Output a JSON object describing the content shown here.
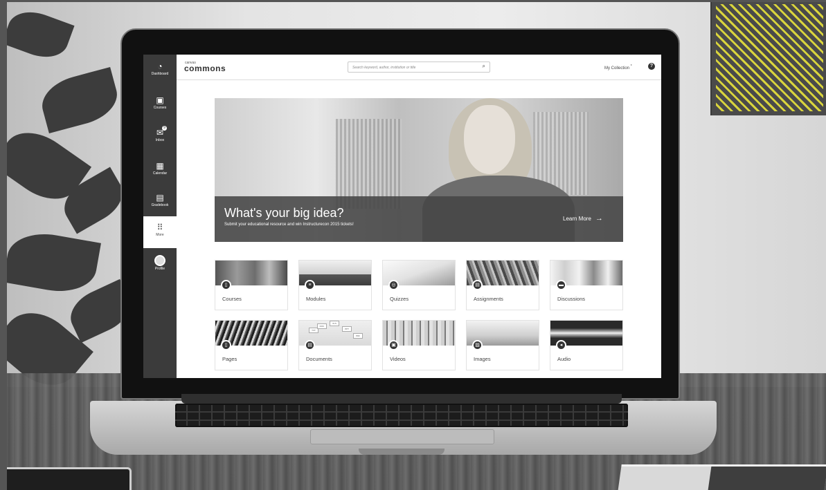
{
  "global_nav": {
    "items": [
      {
        "label": "Dashboard",
        "icon": "dashboard-icon",
        "glyph": "◔"
      },
      {
        "label": "Courses",
        "icon": "courses-icon",
        "glyph": "▣"
      },
      {
        "label": "Inbox",
        "icon": "inbox-icon",
        "glyph": "✉"
      },
      {
        "label": "Calendar",
        "icon": "calendar-icon",
        "glyph": "▦"
      },
      {
        "label": "Gradebook",
        "icon": "gradebook-icon",
        "glyph": "▤"
      },
      {
        "label": "More",
        "icon": "more-grid-icon",
        "glyph": "⠿"
      },
      {
        "label": "Profile",
        "icon": "profile-avatar-icon",
        "glyph": ""
      }
    ],
    "inbox_badge": "9"
  },
  "header": {
    "brand_small": "canvas",
    "brand": "commons",
    "search_placeholder": "Search keyword, author, institution or title",
    "my_collection": "My Collection",
    "my_collection_marker": "*",
    "help_glyph": "?"
  },
  "hero": {
    "title": "What's your big idea?",
    "subtitle": "Submit your educational resource and win Instructurecon 2015 tickets!",
    "cta": "Learn More",
    "cta_arrow": "→"
  },
  "categories": [
    {
      "label": "Courses",
      "icon": "course-icon",
      "glyph": "▯"
    },
    {
      "label": "Modules",
      "icon": "module-icon",
      "glyph": "≡"
    },
    {
      "label": "Quizzes",
      "icon": "quiz-icon",
      "glyph": "◎"
    },
    {
      "label": "Assignments",
      "icon": "assignment-icon",
      "glyph": "▤"
    },
    {
      "label": "Discussions",
      "icon": "discussion-icon",
      "glyph": "▬"
    },
    {
      "label": "Pages",
      "icon": "page-icon",
      "glyph": "▯"
    },
    {
      "label": "Documents",
      "icon": "document-icon",
      "glyph": "▤"
    },
    {
      "label": "Videos",
      "icon": "video-icon",
      "glyph": "▣"
    },
    {
      "label": "Images",
      "icon": "image-icon",
      "glyph": "▨"
    },
    {
      "label": "Audio",
      "icon": "audio-icon",
      "glyph": "◂"
    }
  ],
  "document_tags": [
    "TXT",
    "DOC",
    "XLS",
    "PPT",
    "PDF"
  ],
  "colors": {
    "nav_bg": "#3b3b3b",
    "accent_stripes": "#d9d43c"
  }
}
